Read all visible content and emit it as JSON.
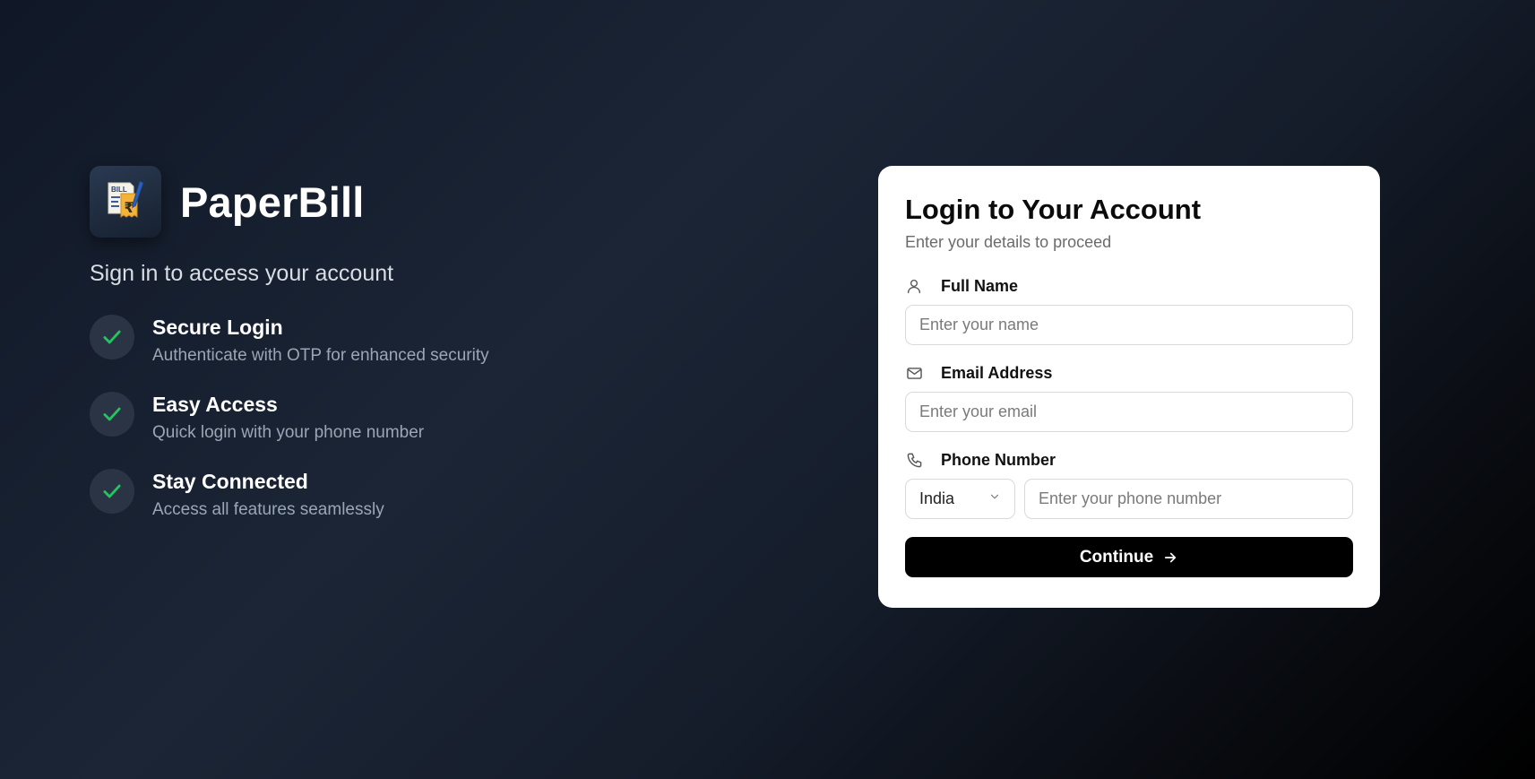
{
  "brand": {
    "logo_text": "BILL",
    "logo_icon": "bill-rupee-icon",
    "name": "PaperBill",
    "tagline": "Sign in to access your account"
  },
  "features": [
    {
      "icon": "check-icon",
      "title": "Secure Login",
      "description": "Authenticate with OTP for enhanced security"
    },
    {
      "icon": "check-icon",
      "title": "Easy Access",
      "description": "Quick login with your phone number"
    },
    {
      "icon": "check-icon",
      "title": "Stay Connected",
      "description": "Access all features seamlessly"
    }
  ],
  "login": {
    "title": "Login to Your Account",
    "subtitle": "Enter your details to proceed",
    "full_name": {
      "icon": "user-icon",
      "label": "Full Name",
      "value": "",
      "placeholder": "Enter your name"
    },
    "email": {
      "icon": "mail-icon",
      "label": "Email Address",
      "value": "",
      "placeholder": "Enter your email"
    },
    "phone": {
      "icon": "phone-icon",
      "label": "Phone Number",
      "country": "India",
      "value": "",
      "placeholder": "Enter your phone number"
    },
    "continue_label": "Continue"
  },
  "colors": {
    "accent_check": "#22c55e",
    "button_bg": "#000000",
    "card_bg": "#ffffff"
  }
}
